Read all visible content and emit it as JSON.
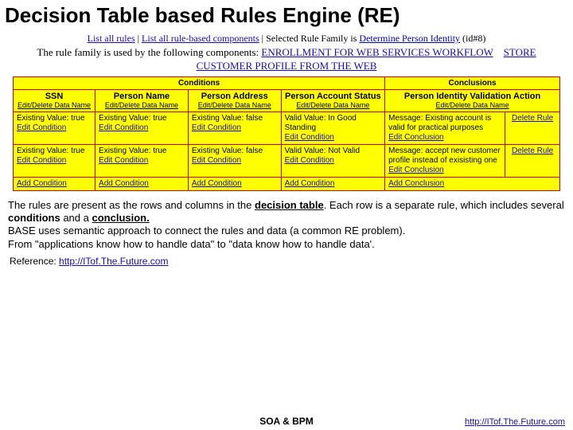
{
  "title": "Decision Table based Rules Engine (RE)",
  "topbar": {
    "list_all": "List all rules",
    "list_comp": "List all rule-based components",
    "selected_prefix": "Selected Rule Family is ",
    "family": "Determine Person Identity",
    "id_suffix": "(id#8)"
  },
  "usedby": {
    "prefix": "The rule family is used by the following components: ",
    "c1": "ENROLLMENT FOR WEB SERVICES WORKFLOW",
    "c2": "STORE CUSTOMER PROFILE FROM THE WEB"
  },
  "headers": {
    "conditions": "Conditions",
    "conclusions": "Conclusions"
  },
  "cols": {
    "c1": "SSN",
    "c2": "Person Name",
    "c3": "Person Address",
    "c4": "Person Account Status",
    "c5": "Person Identity Validation Action",
    "edit": "Edit/Delete Data Name"
  },
  "rows": [
    {
      "v1": "Existing Value: true",
      "v2": "Existing Value: true",
      "v3": "Existing Value: false",
      "v4": "Valid Value: In Good Standing",
      "concl": "Message: Existing account is valid for practical purposes",
      "editc": "Edit Condition",
      "editx": "Edit Conclusion",
      "del": "Delete Rule"
    },
    {
      "v1": "Existing Value: true",
      "v2": "Existing Value: true",
      "v3": "Existing Value: false",
      "v4": "Valid Value: Not Valid",
      "concl": "Message: accept new customer profile instead of exisisting one",
      "editc": "Edit Condition",
      "editx": "Edit Conclusion",
      "del": "Delete Rule"
    }
  ],
  "addrow": {
    "addc": "Add Condition",
    "addx": "Add Conclusion"
  },
  "body": {
    "p1a": "The rules are present as the rows and columns in the ",
    "p1b": "decision table",
    "p1c": ". Each row is a separate rule, which includes several ",
    "p1d": "conditions",
    "p1e": " and a ",
    "p1f": "conclusion.",
    "p2": "BASE uses semantic approach to connect the rules and data (a common RE problem).",
    "p3": "From \"applications know how to handle data\" to \"data know how to handle data'."
  },
  "ref": {
    "label": "Reference: ",
    "url": "http://ITof.The.Future.com"
  },
  "footer": {
    "mid": "SOA & BPM",
    "right": "http://ITof.The.Future.com"
  }
}
